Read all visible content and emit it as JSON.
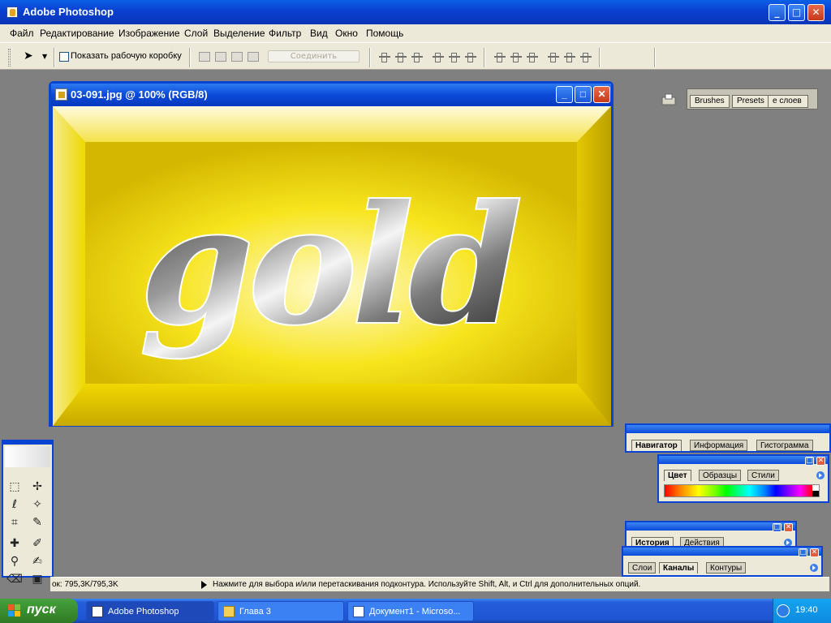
{
  "app": {
    "title": "Adobe Photoshop"
  },
  "menu": [
    "Файл",
    "Редактирование",
    "Изображение",
    "Слой",
    "Выделение",
    "Фильтр",
    "Вид",
    "Окно",
    "Помощь"
  ],
  "options": {
    "show_bbox_label": "Показать рабочую коробку",
    "combine_label": "Соединить",
    "palette_well_tabs": [
      "Brushes",
      "Presets",
      "е слоев"
    ]
  },
  "document": {
    "title": "03-091.jpg @ 100% (RGB/8)",
    "artwork_text": "gold"
  },
  "status": {
    "doc_size": "ок: 795,3K/795,3K",
    "hint": "Нажмите для выбора и/или перетаскивания подконтура.  Используйте Shift, Alt, и Ctrl для дополнительных опций."
  },
  "palettes": {
    "navigator_group": [
      "Навигатор",
      "Информация",
      "Гистограмма"
    ],
    "color_group": [
      "Цвет",
      "Образцы",
      "Стили"
    ],
    "history_group": [
      "История",
      "Действия"
    ],
    "layers_group": [
      "Слои",
      "Каналы",
      "Контуры"
    ]
  },
  "taskbar": {
    "start_label": "пуск",
    "items": [
      "Adobe Photoshop",
      "Глава 3",
      "Документ1 - Microso..."
    ],
    "clock": "19:40"
  },
  "colors": {
    "xp_blue": "#0a42d2",
    "gold": "#e5cc00",
    "desktop_gray": "#808080",
    "start_green": "#3a8d2f"
  }
}
